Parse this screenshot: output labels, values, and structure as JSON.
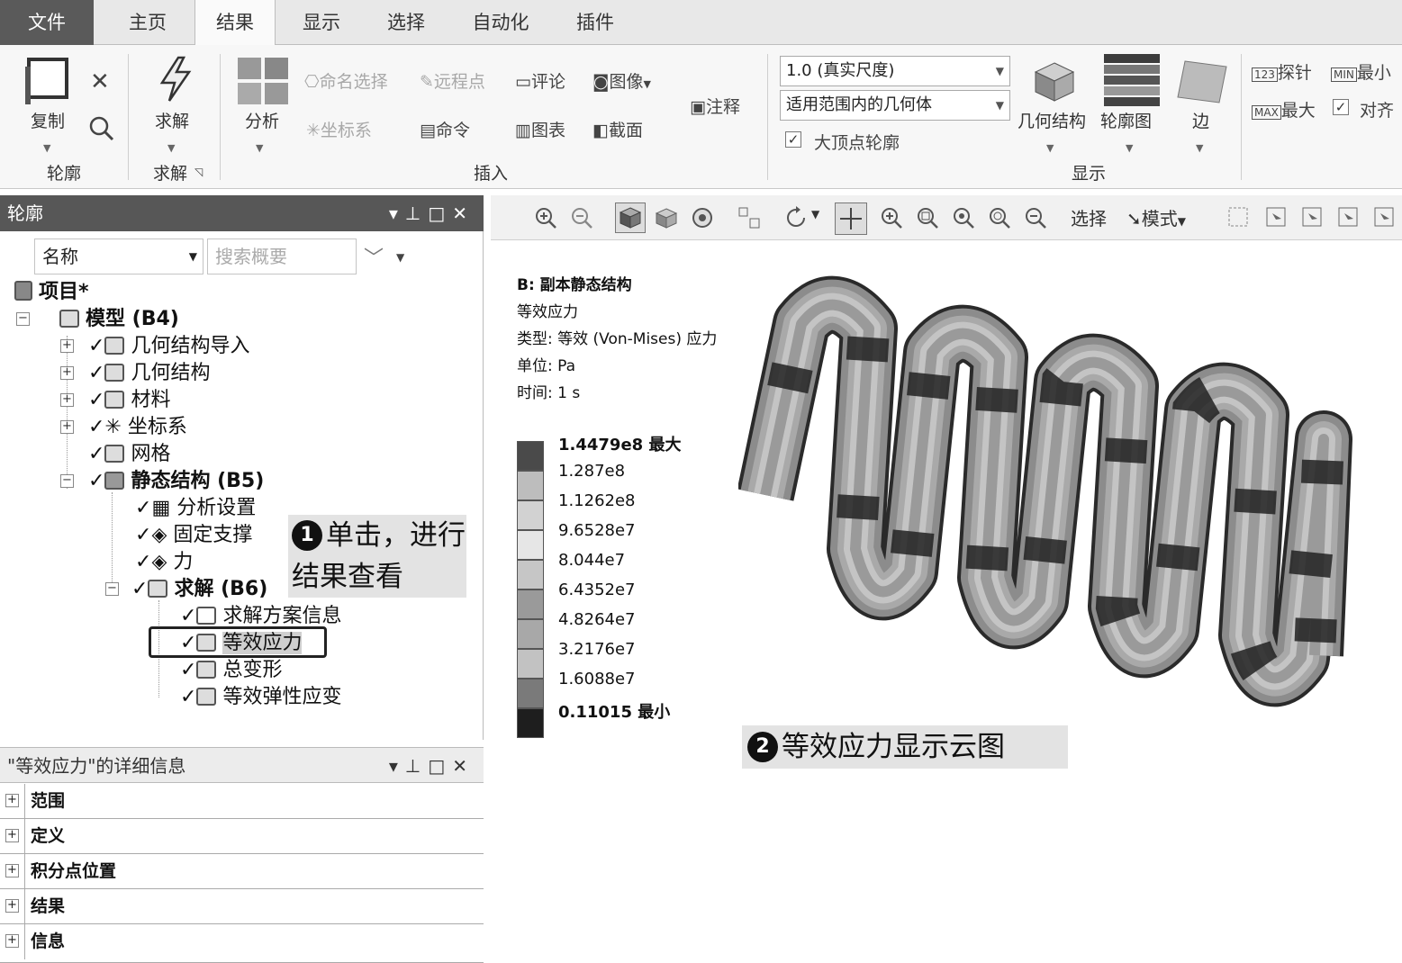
{
  "tabs": [
    {
      "label": "文件"
    },
    {
      "label": "主页"
    },
    {
      "label": "结果"
    },
    {
      "label": "显示"
    },
    {
      "label": "选择"
    },
    {
      "label": "自动化"
    },
    {
      "label": "插件"
    }
  ],
  "ribbon": {
    "outline_group": {
      "copy": "复制",
      "label": "轮廓"
    },
    "solve_group": {
      "solve": "求解",
      "label": "求解"
    },
    "insert_group": {
      "analysis": "分析",
      "named_selection": "命名选择",
      "remote_point": "远程点",
      "comment": "评论",
      "image": "图像",
      "annotation": "注释",
      "coordinate_system": "坐标系",
      "command": "命令",
      "chart": "图表",
      "section": "截面",
      "label": "插入"
    },
    "display_group": {
      "scale_value": "1.0 (真实尺度)",
      "geometry_scope": "适用范围内的几何体",
      "max_vertex_contour": "大顶点轮廓",
      "geometry": "几何结构",
      "contour": "轮廓图",
      "edge": "边",
      "label": "显示"
    },
    "probe_group": {
      "probe": "探针",
      "min": "最小",
      "max": "最大",
      "align": "对齐"
    }
  },
  "outline": {
    "title": "轮廓",
    "filter_name": "名称",
    "search_placeholder": "搜索概要",
    "tree": {
      "project": "项目*",
      "model": "模型 (B4)",
      "geometry_import": "几何结构导入",
      "geometry": "几何结构",
      "materials": "材料",
      "coord_systems": "坐标系",
      "mesh": "网格",
      "static_structural": "静态结构 (B5)",
      "analysis_settings": "分析设置",
      "fixed_support": "固定支撑",
      "force": "力",
      "solution": "求解 (B6)",
      "solution_info": "求解方案信息",
      "equiv_stress": "等效应力",
      "total_deformation": "总变形",
      "equiv_elastic_strain": "等效弹性应变"
    }
  },
  "details": {
    "title": "\"等效应力\"的详细信息",
    "sections": [
      "范围",
      "定义",
      "积分点位置",
      "结果",
      "信息"
    ]
  },
  "graphics_toolbar": {
    "select": "选择",
    "mode": "模式"
  },
  "viewport": {
    "info": {
      "analysis": "B: 副本静态结构",
      "result": "等效应力",
      "type": "类型: 等效 (Von-Mises) 应力",
      "unit": "单位: Pa",
      "time": "时间: 1 s"
    },
    "legend": {
      "values": [
        "1.4479e8 最大",
        "1.287e8",
        "1.1262e8",
        "9.6528e7",
        "8.044e7",
        "6.4352e7",
        "4.8264e7",
        "3.2176e7",
        "1.6088e7",
        "0.11015 最小"
      ],
      "colors": [
        "#4a4a4a",
        "#bdbdbd",
        "#d2d2d2",
        "#e6e6e6",
        "#c6c6c6",
        "#9a9a9a",
        "#a8a8a8",
        "#c2c2c2",
        "#7a7a7a",
        "#1e1e1e"
      ]
    }
  },
  "callouts": {
    "step1_num": "1",
    "step1_text": "单击，进行结果查看",
    "step2_num": "2",
    "step2_text": "等效应力显示云图"
  }
}
